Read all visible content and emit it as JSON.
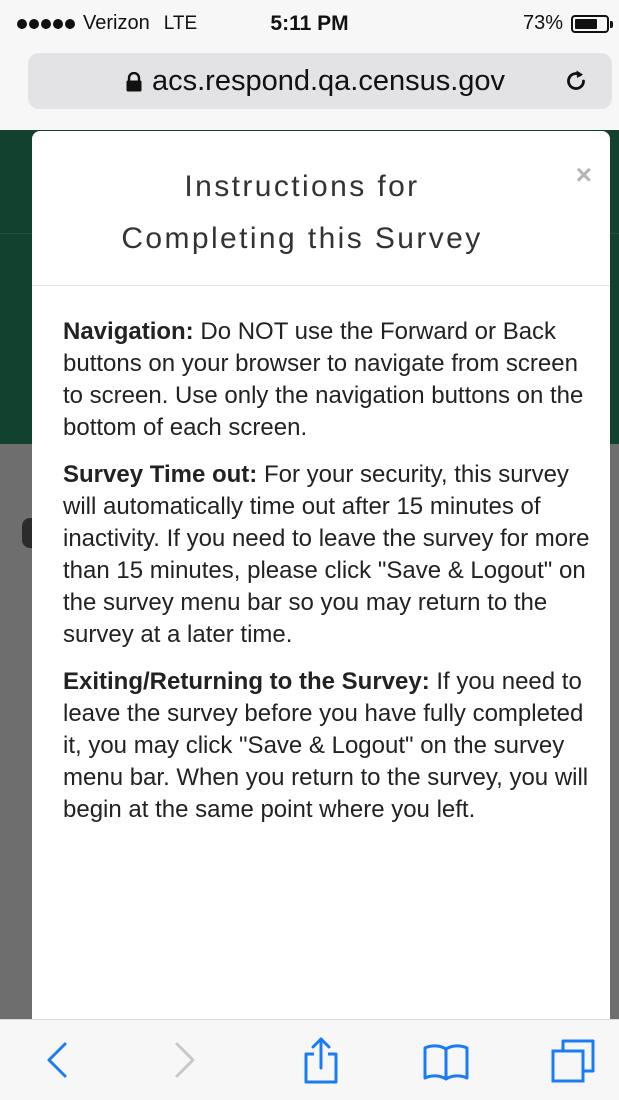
{
  "status_bar": {
    "carrier": "Verizon",
    "network": "LTE",
    "time": "5:11 PM",
    "battery_text": "73%",
    "battery_level": 0.73
  },
  "browser": {
    "url": "acs.respond.qa.census.gov"
  },
  "modal": {
    "title_line1": "Instructions for",
    "title_line2": "Completing this Survey",
    "close_label": "×",
    "sections": [
      {
        "heading": "Navigation:",
        "text": " Do NOT use the Forward or Back buttons on your browser to navigate from screen to screen. Use only the navigation buttons on the bottom of each screen."
      },
      {
        "heading": "Survey Time out:",
        "text": " For your security, this survey will automatically time out after 15 minutes of inactivity. If you need to leave the survey for more than 15 minutes, please click \"Save & Logout\" on the survey menu bar so you may return to the survey at a later time."
      },
      {
        "heading": "Exiting/Returning to the Survey:",
        "text": " If you need to leave the survey before you have fully completed it, you may click \"Save & Logout\" on the survey menu bar. When you return to the survey, you will begin at the same point where you left."
      }
    ]
  },
  "toolbar": {
    "accent_color": "#1a7cf5",
    "disabled_color": "#c8c8cc",
    "icons": [
      "back-arrow-icon",
      "forward-arrow-icon",
      "share-icon",
      "bookmarks-icon",
      "tabs-icon"
    ]
  }
}
